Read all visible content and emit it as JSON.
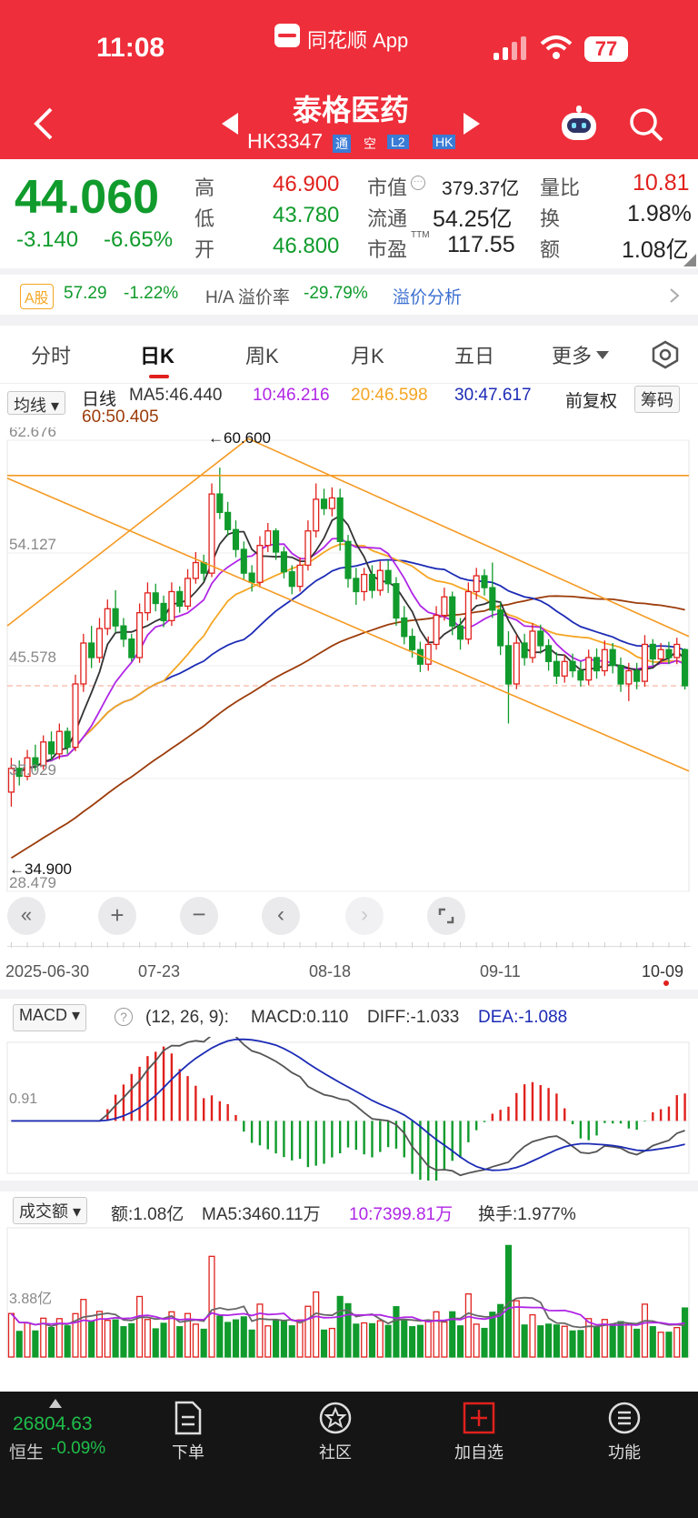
{
  "status_bar": {
    "time": "11:08",
    "app_name": "同花顺 App",
    "battery": "77"
  },
  "header": {
    "title": "泰格医药",
    "code": "HK3347",
    "badges": [
      "通",
      "空",
      "L2",
      "HK"
    ]
  },
  "quote": {
    "price": "44.060",
    "change": "-3.140",
    "change_pct": "-6.65%",
    "high_label": "高",
    "high": "46.900",
    "low_label": "低",
    "low": "43.780",
    "open_label": "开",
    "open": "46.800",
    "mcap_label": "市值",
    "mcap": "379.37亿",
    "float_label": "流通",
    "float": "54.25亿",
    "pe_label": "市盈",
    "pe_sup": "TTM",
    "pe": "117.55",
    "vr_label": "量比",
    "vr": "10.81",
    "turn_label": "换",
    "turn": "1.98%",
    "amt_label": "额",
    "amt": "1.08亿"
  },
  "ah_bar": {
    "tag": "A股",
    "a_price": "57.29",
    "a_change": "-1.22%",
    "premium_label": "H/A 溢价率",
    "premium": "-29.79%",
    "link": "溢价分析"
  },
  "tabs": [
    "分时",
    "日K",
    "周K",
    "月K",
    "五日",
    "更多"
  ],
  "active_tab": "日K",
  "kline": {
    "indicator_dropdown": "均线",
    "period": "日线",
    "ma5": "MA5:46.440",
    "ma10": "10:46.216",
    "ma20": "20:46.598",
    "ma30": "30:47.617",
    "ma60": "60:50.405",
    "adj_label": "前复权",
    "chip_label": "筹码",
    "y_ticks": [
      "62.676",
      "54.127",
      "45.578",
      "37.029",
      "28.479"
    ],
    "high_marker": "←60.600",
    "low_marker": "←34.900",
    "x_dates": [
      "2025-06-30",
      "07-23",
      "08-18",
      "09-11",
      "10-09"
    ]
  },
  "macd": {
    "dropdown": "MACD",
    "params": "(12, 26, 9):",
    "macd": "MACD:0.110",
    "diff": "DIFF:-1.033",
    "dea": "DEA:-1.088",
    "y_tick": "0.91"
  },
  "volume": {
    "dropdown": "成交额",
    "amt": "额:1.08亿",
    "ma5": "MA5:3460.11万",
    "ma10": "10:7399.81万",
    "turnover": "换手:1.977%",
    "y_tick": "3.88亿"
  },
  "dock": {
    "index_value": "26804.63",
    "index_name": "恒生",
    "index_change": "-0.09%",
    "items": [
      "下单",
      "社区",
      "加自选",
      "功能"
    ]
  },
  "colors": {
    "header_bg": "#ee2e3a",
    "up": "#e0211d",
    "down": "#109b2c",
    "ma5": "#333333",
    "ma10": "#b026e6",
    "ma20": "#f5a623",
    "ma30": "#1c2bb5",
    "ma60": "#9c3c0a"
  },
  "chart_data": {
    "type": "candlestick",
    "title": "",
    "y_range": [
      28.479,
      62.676
    ],
    "x_labels": [
      "2025-06-30",
      "07-23",
      "08-18",
      "09-11",
      "10-09"
    ],
    "y_labels": [
      "62.676",
      "54.127",
      "45.578",
      "37.029",
      "28.479"
    ],
    "candles": [
      {
        "o": 36.0,
        "c": 37.8,
        "h": 38.6,
        "l": 34.9
      },
      {
        "o": 37.8,
        "c": 37.2,
        "h": 38.4,
        "l": 36.5
      },
      {
        "o": 37.2,
        "c": 38.6,
        "h": 39.2,
        "l": 36.9
      },
      {
        "o": 38.6,
        "c": 38.0,
        "h": 39.6,
        "l": 37.6
      },
      {
        "o": 38.0,
        "c": 39.8,
        "h": 40.3,
        "l": 37.7
      },
      {
        "o": 39.8,
        "c": 38.9,
        "h": 40.6,
        "l": 38.4
      },
      {
        "o": 38.9,
        "c": 40.6,
        "h": 41.2,
        "l": 38.5
      },
      {
        "o": 40.6,
        "c": 39.4,
        "h": 40.9,
        "l": 38.9
      },
      {
        "o": 39.4,
        "c": 44.2,
        "h": 44.9,
        "l": 39.1
      },
      {
        "o": 44.2,
        "c": 47.3,
        "h": 48.0,
        "l": 43.6
      },
      {
        "o": 47.3,
        "c": 46.2,
        "h": 48.6,
        "l": 45.4
      },
      {
        "o": 46.2,
        "c": 48.4,
        "h": 49.2,
        "l": 45.8
      },
      {
        "o": 48.4,
        "c": 49.9,
        "h": 50.6,
        "l": 47.9
      },
      {
        "o": 49.9,
        "c": 48.6,
        "h": 51.3,
        "l": 48.1
      },
      {
        "o": 48.6,
        "c": 47.6,
        "h": 49.2,
        "l": 47.0
      },
      {
        "o": 47.6,
        "c": 46.2,
        "h": 48.0,
        "l": 45.9
      },
      {
        "o": 46.2,
        "c": 49.6,
        "h": 50.3,
        "l": 45.8
      },
      {
        "o": 49.6,
        "c": 51.1,
        "h": 51.9,
        "l": 49.0
      },
      {
        "o": 51.1,
        "c": 50.3,
        "h": 51.8,
        "l": 49.7
      },
      {
        "o": 50.3,
        "c": 49.0,
        "h": 50.9,
        "l": 48.5
      },
      {
        "o": 49.0,
        "c": 51.2,
        "h": 51.9,
        "l": 48.6
      },
      {
        "o": 51.2,
        "c": 50.1,
        "h": 51.6,
        "l": 49.6
      },
      {
        "o": 50.1,
        "c": 52.2,
        "h": 52.9,
        "l": 49.8
      },
      {
        "o": 52.2,
        "c": 53.4,
        "h": 54.2,
        "l": 51.8
      },
      {
        "o": 53.4,
        "c": 52.6,
        "h": 54.0,
        "l": 52.0
      },
      {
        "o": 52.6,
        "c": 58.6,
        "h": 59.4,
        "l": 52.3
      },
      {
        "o": 58.6,
        "c": 57.2,
        "h": 60.6,
        "l": 56.7
      },
      {
        "o": 57.2,
        "c": 55.9,
        "h": 58.0,
        "l": 55.4
      },
      {
        "o": 55.9,
        "c": 54.4,
        "h": 56.6,
        "l": 53.8
      },
      {
        "o": 54.4,
        "c": 52.6,
        "h": 55.0,
        "l": 52.1
      },
      {
        "o": 52.6,
        "c": 51.9,
        "h": 53.2,
        "l": 51.2
      },
      {
        "o": 51.9,
        "c": 54.7,
        "h": 55.4,
        "l": 51.5
      },
      {
        "o": 54.7,
        "c": 55.8,
        "h": 56.4,
        "l": 54.2
      },
      {
        "o": 55.8,
        "c": 54.2,
        "h": 56.0,
        "l": 53.6
      },
      {
        "o": 54.2,
        "c": 52.7,
        "h": 54.6,
        "l": 52.2
      },
      {
        "o": 52.7,
        "c": 51.6,
        "h": 53.2,
        "l": 51.0
      },
      {
        "o": 51.6,
        "c": 53.2,
        "h": 53.8,
        "l": 51.2
      },
      {
        "o": 53.2,
        "c": 55.8,
        "h": 56.6,
        "l": 52.8
      },
      {
        "o": 55.8,
        "c": 58.2,
        "h": 59.4,
        "l": 55.3
      },
      {
        "o": 58.2,
        "c": 57.5,
        "h": 59.0,
        "l": 57.0
      },
      {
        "o": 57.5,
        "c": 58.3,
        "h": 59.1,
        "l": 56.9
      },
      {
        "o": 58.3,
        "c": 55.0,
        "h": 59.0,
        "l": 54.3
      },
      {
        "o": 55.0,
        "c": 52.2,
        "h": 55.5,
        "l": 51.5
      },
      {
        "o": 52.2,
        "c": 51.2,
        "h": 53.0,
        "l": 50.2
      },
      {
        "o": 51.2,
        "c": 52.5,
        "h": 53.0,
        "l": 50.5
      },
      {
        "o": 52.5,
        "c": 51.3,
        "h": 53.2,
        "l": 50.7
      },
      {
        "o": 51.3,
        "c": 52.8,
        "h": 53.5,
        "l": 50.9
      },
      {
        "o": 52.8,
        "c": 51.8,
        "h": 53.6,
        "l": 51.1
      },
      {
        "o": 51.8,
        "c": 49.2,
        "h": 52.3,
        "l": 48.6
      },
      {
        "o": 49.2,
        "c": 47.8,
        "h": 50.1,
        "l": 47.2
      },
      {
        "o": 47.8,
        "c": 46.8,
        "h": 48.4,
        "l": 46.2
      },
      {
        "o": 46.8,
        "c": 45.7,
        "h": 47.4,
        "l": 45.1
      },
      {
        "o": 45.7,
        "c": 47.2,
        "h": 47.8,
        "l": 45.2
      },
      {
        "o": 47.2,
        "c": 49.4,
        "h": 50.1,
        "l": 46.8
      },
      {
        "o": 49.4,
        "c": 50.8,
        "h": 51.5,
        "l": 49.0
      },
      {
        "o": 50.8,
        "c": 48.6,
        "h": 51.2,
        "l": 47.9
      },
      {
        "o": 48.6,
        "c": 47.6,
        "h": 49.2,
        "l": 46.8
      },
      {
        "o": 47.6,
        "c": 51.2,
        "h": 51.9,
        "l": 47.2
      },
      {
        "o": 51.2,
        "c": 52.4,
        "h": 53.0,
        "l": 50.6
      },
      {
        "o": 52.4,
        "c": 51.5,
        "h": 52.9,
        "l": 50.9
      },
      {
        "o": 51.5,
        "c": 49.8,
        "h": 53.4,
        "l": 49.2
      },
      {
        "o": 49.8,
        "c": 47.1,
        "h": 50.4,
        "l": 46.4
      },
      {
        "o": 47.1,
        "c": 44.2,
        "h": 48.2,
        "l": 41.2
      },
      {
        "o": 44.2,
        "c": 47.3,
        "h": 47.9,
        "l": 43.8
      },
      {
        "o": 47.3,
        "c": 46.2,
        "h": 48.0,
        "l": 45.6
      },
      {
        "o": 46.2,
        "c": 48.2,
        "h": 48.8,
        "l": 45.8
      },
      {
        "o": 48.2,
        "c": 47.1,
        "h": 48.7,
        "l": 46.5
      },
      {
        "o": 47.1,
        "c": 45.9,
        "h": 47.6,
        "l": 45.2
      },
      {
        "o": 45.9,
        "c": 44.8,
        "h": 46.6,
        "l": 44.2
      },
      {
        "o": 44.8,
        "c": 45.9,
        "h": 46.4,
        "l": 44.3
      },
      {
        "o": 45.9,
        "c": 45.2,
        "h": 46.5,
        "l": 44.7
      },
      {
        "o": 45.2,
        "c": 44.5,
        "h": 45.9,
        "l": 44.0
      },
      {
        "o": 44.5,
        "c": 46.2,
        "h": 46.8,
        "l": 44.1
      },
      {
        "o": 46.2,
        "c": 45.2,
        "h": 46.9,
        "l": 44.6
      },
      {
        "o": 45.2,
        "c": 46.8,
        "h": 47.5,
        "l": 44.8
      },
      {
        "o": 46.8,
        "c": 45.6,
        "h": 47.3,
        "l": 45.0
      },
      {
        "o": 45.6,
        "c": 44.2,
        "h": 46.2,
        "l": 43.6
      },
      {
        "o": 44.2,
        "c": 45.2,
        "h": 45.8,
        "l": 42.9
      },
      {
        "o": 45.2,
        "c": 44.4,
        "h": 45.8,
        "l": 43.8
      },
      {
        "o": 44.4,
        "c": 47.2,
        "h": 47.9,
        "l": 44.0
      },
      {
        "o": 47.2,
        "c": 46.1,
        "h": 47.6,
        "l": 45.6
      },
      {
        "o": 46.1,
        "c": 46.8,
        "h": 47.3,
        "l": 45.8
      },
      {
        "o": 46.8,
        "c": 46.2,
        "h": 47.4,
        "l": 45.7
      },
      {
        "o": 46.2,
        "c": 47.2,
        "h": 47.7,
        "l": 45.7
      },
      {
        "o": 46.8,
        "c": 44.06,
        "h": 46.9,
        "l": 43.78
      }
    ],
    "annotations": [
      "←60.600",
      "←34.900"
    ]
  }
}
